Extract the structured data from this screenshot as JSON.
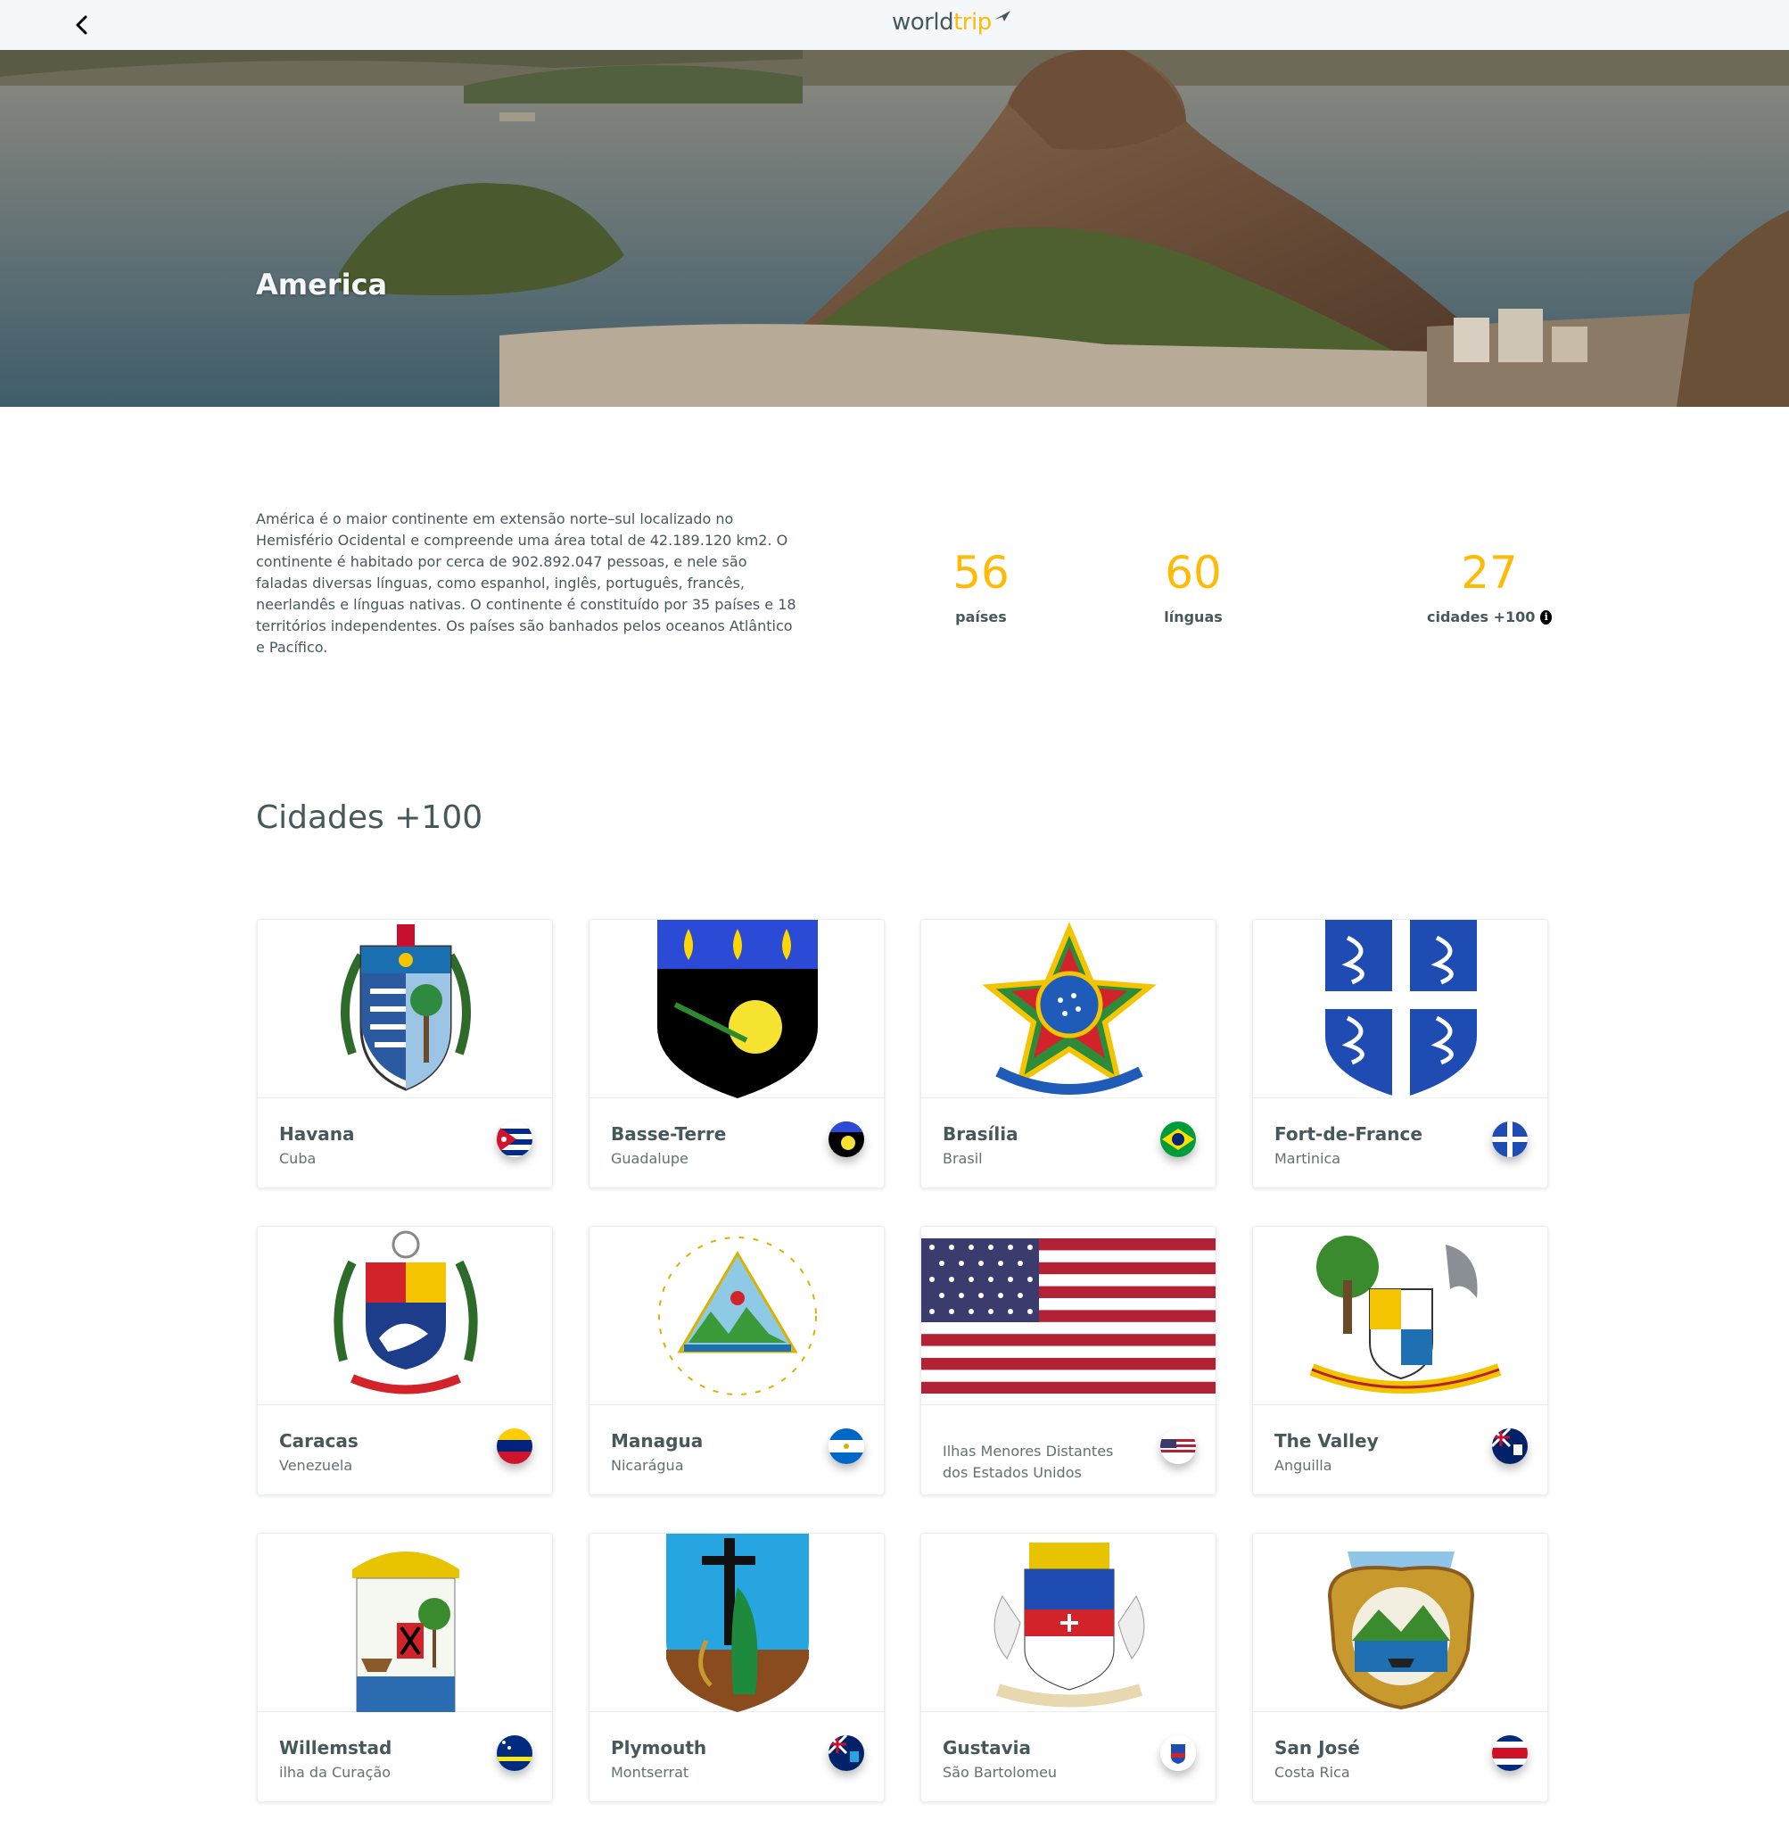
{
  "header": {
    "logo_word": "world",
    "logo_accent": "trip",
    "back_icon": "chevron-left-icon"
  },
  "hero": {
    "title": "America"
  },
  "about": {
    "text": "América é o maior continente em extensão norte–sul localizado no Hemisfério Ocidental e compreende uma área total de 42.189.120 km2. O continente é habitado por cerca de 902.892.047 pessoas, e nele são faladas diversas línguas, como espanhol, inglês, português, francês, neerlandês e línguas nativas. O continente é constituído por 35 países e 18 territórios independentes. Os países são banhados pelos oceanos Atlântico e Pacífico."
  },
  "stats": [
    {
      "value": "56",
      "label": "países"
    },
    {
      "value": "60",
      "label": "línguas"
    },
    {
      "value": "27",
      "label": "cidades +100",
      "info_icon": "info-icon"
    }
  ],
  "section_title": "Cidades +100",
  "colors": {
    "accent": "#FFBA08",
    "text": "#47585B",
    "header_bg": "#F5F8FA"
  },
  "cities": [
    {
      "city": "Havana",
      "country": "Cuba",
      "emblem": "cuba-coat-of-arms",
      "flag": "cuba-flag"
    },
    {
      "city": "Basse-Terre",
      "country": "Guadalupe",
      "emblem": "guadeloupe-coat-of-arms",
      "flag": "guadeloupe-flag"
    },
    {
      "city": "Brasília",
      "country": "Brasil",
      "emblem": "brazil-coat-of-arms",
      "flag": "brazil-flag"
    },
    {
      "city": "Fort-de-France",
      "country": "Martinica",
      "emblem": "martinique-coat-of-arms",
      "flag": "martinique-flag"
    },
    {
      "city": "Caracas",
      "country": "Venezuela",
      "emblem": "venezuela-coat-of-arms",
      "flag": "venezuela-flag"
    },
    {
      "city": "Managua",
      "country": "Nicarágua",
      "emblem": "nicaragua-coat-of-arms",
      "flag": "nicaragua-flag"
    },
    {
      "city": "",
      "country": "Ilhas Menores Distantes dos Estados Unidos",
      "emblem": "usa-flag-large",
      "flag": "usa-flag"
    },
    {
      "city": "The Valley",
      "country": "Anguilla",
      "emblem": "anguilla-coat-of-arms",
      "flag": "anguilla-flag"
    },
    {
      "city": "Willemstad",
      "country": "ilha da Curação",
      "emblem": "curacao-coat-of-arms",
      "flag": "curacao-flag"
    },
    {
      "city": "Plymouth",
      "country": "Montserrat",
      "emblem": "montserrat-coat-of-arms",
      "flag": "montserrat-flag"
    },
    {
      "city": "Gustavia",
      "country": "São Bartolomeu",
      "emblem": "saint-barthelemy-coat-of-arms",
      "flag": "saint-barthelemy-flag"
    },
    {
      "city": "San José",
      "country": "Costa Rica",
      "emblem": "costa-rica-coat-of-arms",
      "flag": "costa-rica-flag"
    }
  ]
}
